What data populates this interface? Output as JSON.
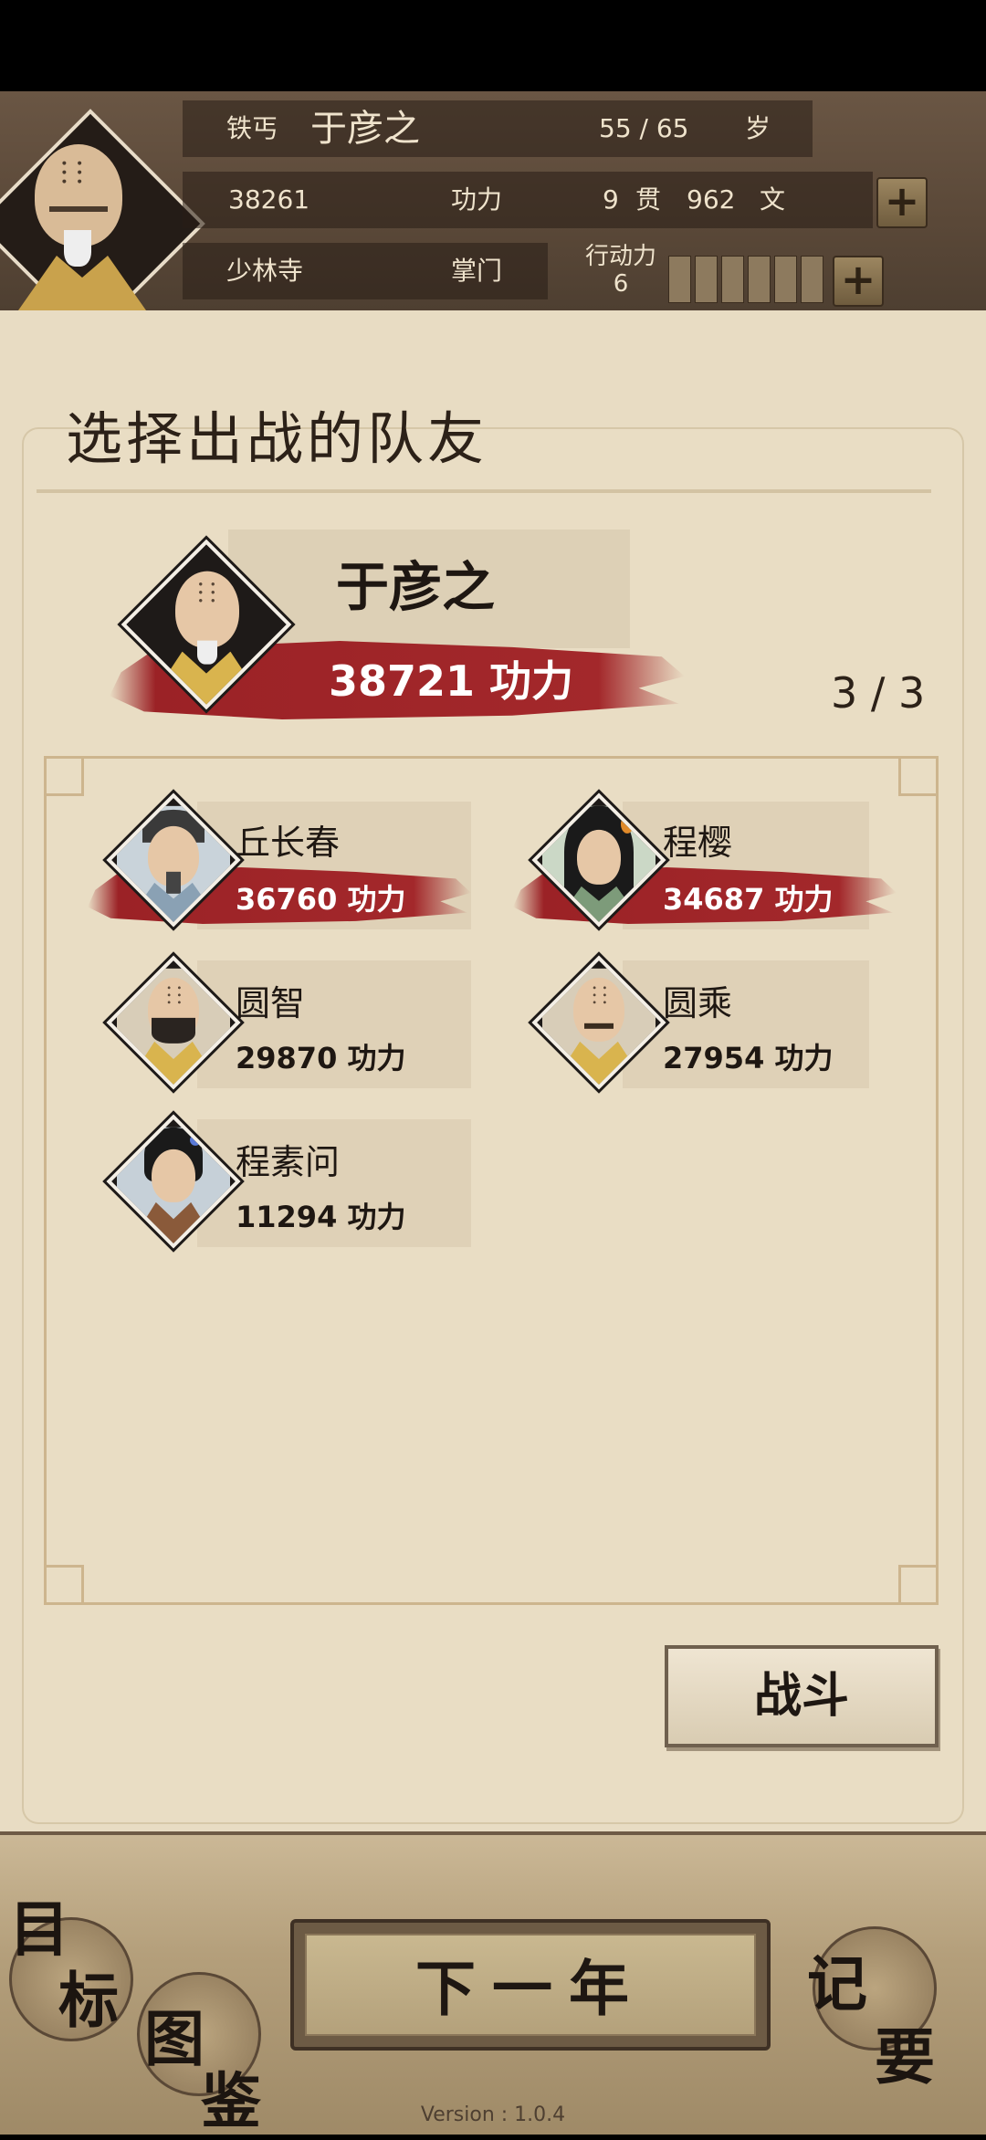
{
  "header": {
    "title_label": "铁丐",
    "player_name": "于彦之",
    "age": "55 / 65",
    "age_unit": "岁",
    "power_value": "38261",
    "power_label": "功力",
    "money_guan": "9",
    "money_guan_unit": "贯",
    "money_wen": "962",
    "money_wen_unit": "文",
    "sect": "少林寺",
    "position": "掌门",
    "action_label": "行动力",
    "action_value": "6",
    "plus_symbol": "+"
  },
  "panel": {
    "title": "选择出战的队友",
    "count": "3 / 3"
  },
  "leader": {
    "name": "于彦之",
    "power": "38721 功力"
  },
  "members": [
    {
      "name": "丘长春",
      "power": "36760 功力",
      "selected": true
    },
    {
      "name": "程樱",
      "power": "34687 功力",
      "selected": true
    },
    {
      "name": "圆智",
      "power": "29870 功力",
      "selected": false
    },
    {
      "name": "圆乘",
      "power": "27954 功力",
      "selected": false
    },
    {
      "name": "程素问",
      "power": "11294 功力",
      "selected": false
    }
  ],
  "fight_button": "战斗",
  "bottom_nav": {
    "goals": [
      "目",
      "标"
    ],
    "codex": [
      "图",
      "鉴"
    ],
    "notes": [
      "记",
      "要"
    ],
    "next_year": "下一年",
    "version": "Version : 1.0.4"
  },
  "colors": {
    "brush_red": "#9b2226",
    "parchment": "#e8dcc3",
    "header_brown": "#5a4838"
  }
}
